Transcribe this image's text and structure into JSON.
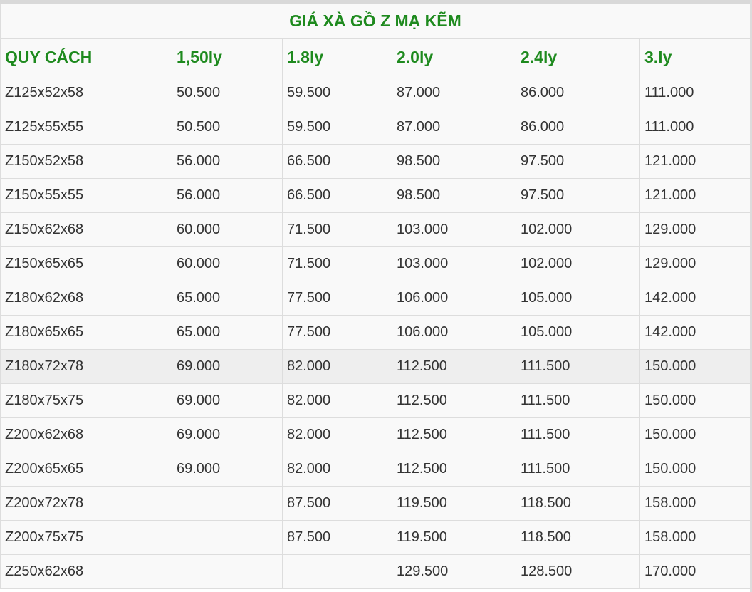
{
  "table": {
    "title": "GIÁ XÀ GỒ Z MẠ KẼM",
    "headers": [
      "QUY CÁCH",
      "1,50ly",
      "1.8ly",
      "2.0ly",
      "2.4ly",
      "3.ly"
    ],
    "rows": [
      [
        "Z125x52x58",
        "50.500",
        "59.500",
        "87.000",
        "86.000",
        "111.000"
      ],
      [
        "Z125x55x55",
        "50.500",
        "59.500",
        "87.000",
        "86.000",
        "111.000"
      ],
      [
        "Z150x52x58",
        "56.000",
        "66.500",
        "98.500",
        "97.500",
        "121.000"
      ],
      [
        "Z150x55x55",
        "56.000",
        "66.500",
        "98.500",
        "97.500",
        "121.000"
      ],
      [
        "Z150x62x68",
        "60.000",
        "71.500",
        "103.000",
        "102.000",
        "129.000"
      ],
      [
        "Z150x65x65",
        "60.000",
        "71.500",
        "103.000",
        "102.000",
        "129.000"
      ],
      [
        "Z180x62x68",
        "65.000",
        "77.500",
        "106.000",
        "105.000",
        "142.000"
      ],
      [
        "Z180x65x65",
        "65.000",
        "77.500",
        "106.000",
        "105.000",
        "142.000"
      ],
      [
        "Z180x72x78",
        "69.000",
        "82.000",
        "112.500",
        "111.500",
        "150.000"
      ],
      [
        "Z180x75x75",
        "69.000",
        "82.000",
        "112.500",
        "111.500",
        "150.000"
      ],
      [
        "Z200x62x68",
        "69.000",
        "82.000",
        "112.500",
        "111.500",
        "150.000"
      ],
      [
        "Z200x65x65",
        "69.000",
        "82.000",
        "112.500",
        "111.500",
        "150.000"
      ],
      [
        "Z200x72x78",
        "",
        "87.500",
        "119.500",
        "118.500",
        "158.000"
      ],
      [
        "Z200x75x75",
        "",
        "87.500",
        "119.500",
        "118.500",
        "158.000"
      ],
      [
        "Z250x62x68",
        "",
        "",
        "129.500",
        "128.500",
        "170.000"
      ]
    ],
    "highlight_row": 8,
    "colors": {
      "header_text": "#1e8a1e",
      "body_text": "#333333",
      "border": "#dddddd",
      "row_background": "#f9f9f9",
      "highlight_background": "#eeeeee"
    }
  }
}
